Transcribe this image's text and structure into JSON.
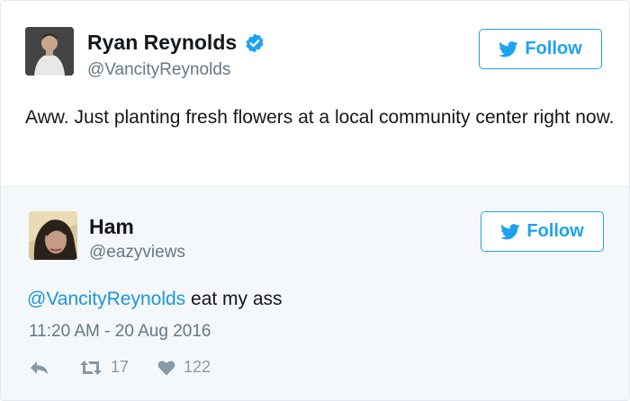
{
  "original_tweet": {
    "display_name": "Ryan Reynolds",
    "handle": "@VancityReynolds",
    "verified": true,
    "follow_label": "Follow",
    "text": "Aww. Just planting fresh flowers at a local community center right now."
  },
  "reply_tweet": {
    "display_name": "Ham",
    "handle": "@eazyviews",
    "follow_label": "Follow",
    "mention": "@VancityReynolds",
    "text_rest": " eat my ass",
    "timestamp": "11:20 AM - 20 Aug 2016",
    "retweet_count": "17",
    "like_count": "122"
  },
  "colors": {
    "twitter_blue": "#1da1f2",
    "mention_blue": "#1b95e0",
    "secondary_text": "#657786",
    "action_gray": "#8899a6",
    "reply_background": "#f5f8fa"
  },
  "icons": [
    "twitter-bird-icon",
    "verified-badge-icon",
    "reply-icon",
    "retweet-icon",
    "heart-icon"
  ]
}
